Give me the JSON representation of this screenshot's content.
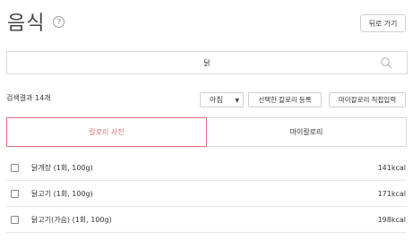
{
  "header": {
    "title": "음식",
    "help_glyph": "?",
    "back_label": "뒤로 가기"
  },
  "search": {
    "value": "닭",
    "placeholder": ""
  },
  "results": {
    "count_label": "검색결과 14개"
  },
  "actions": {
    "meal_select_value": "아침",
    "register_label": "선택한 칼로리 등록",
    "direct_input_label": "마이칼로리 직접입력"
  },
  "tabs": [
    {
      "label": "칼로리 사전",
      "active": true
    },
    {
      "label": "마이칼로리",
      "active": false
    }
  ],
  "items": [
    {
      "name": "닭개장  (1회, 100g)",
      "kcal": "141kcal"
    },
    {
      "name": "닭고기  (1회, 100g)",
      "kcal": "171kcal"
    },
    {
      "name": "닭고기(가슴)  (1회, 100g)",
      "kcal": "198kcal"
    }
  ],
  "colors": {
    "accent": "#e36c7c",
    "border": "#d9d9d9"
  }
}
